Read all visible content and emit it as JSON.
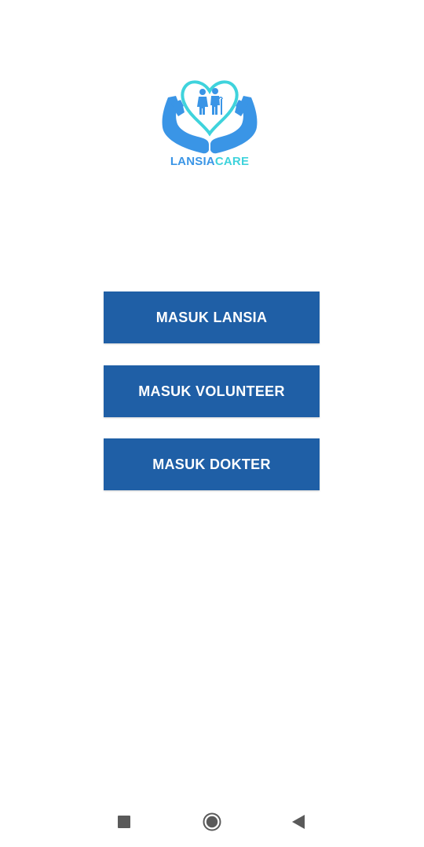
{
  "app": {
    "logo": {
      "text_part1": "LANSIA",
      "text_part2": "CARE",
      "icon": "heart-elderly-couple-hands-icon",
      "colors": {
        "hands": "#3a95e6",
        "heart": "#3fd3dc",
        "figures": "#3a95e6"
      }
    }
  },
  "login_options": {
    "lansia_label": "MASUK LANSIA",
    "volunteer_label": "MASUK VOLUNTEER",
    "dokter_label": "MASUK DOKTER",
    "button_color": "#1f5fa6",
    "text_color": "#ffffff"
  },
  "navigation_bar": {
    "recents_icon": "square-recents-icon",
    "home_icon": "circle-home-icon",
    "back_icon": "triangle-back-icon",
    "icon_color": "#5a5a5a"
  }
}
